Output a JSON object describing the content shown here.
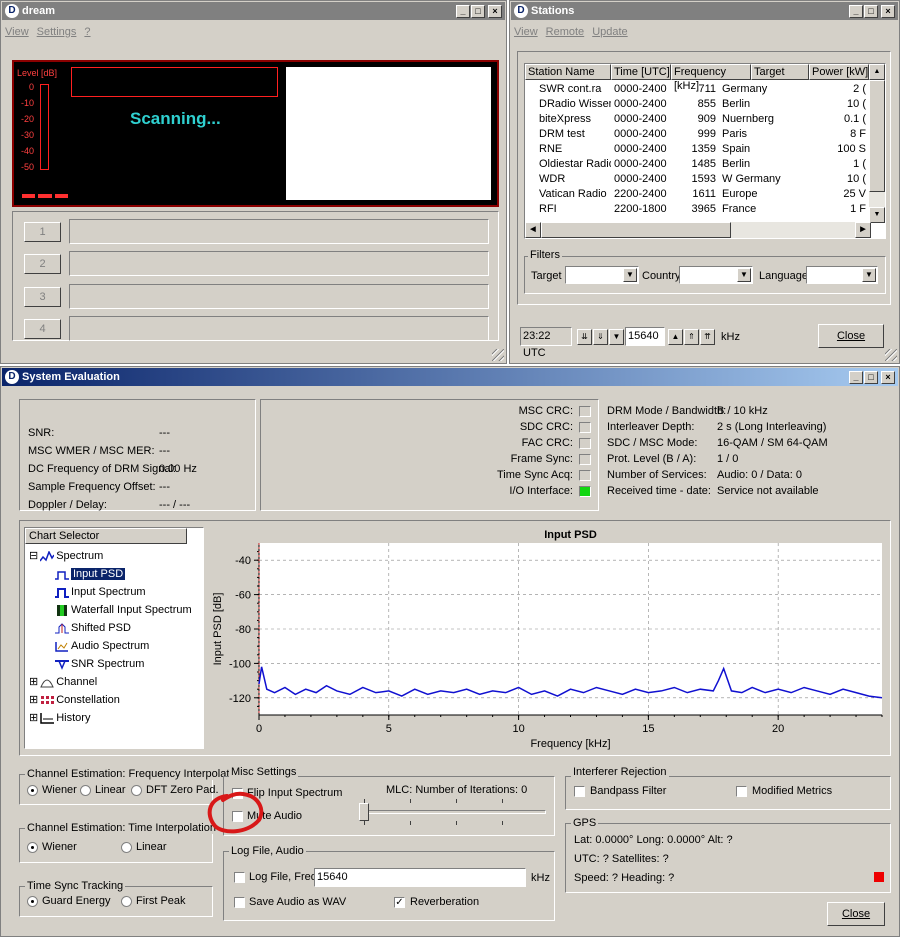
{
  "dream": {
    "title": "dream",
    "menu": [
      "View",
      "Settings",
      "?"
    ],
    "level_label": "Level [dB]",
    "level_ticks": [
      "0",
      "-10",
      "-20",
      "-30",
      "-40",
      "-50"
    ],
    "status": "Scanning...",
    "services": [
      "1",
      "2",
      "3",
      "4"
    ]
  },
  "stations": {
    "title": "Stations",
    "menu": [
      "View",
      "Remote",
      "Update"
    ],
    "columns": [
      "Station Name",
      "Time [UTC]",
      "Frequency [kHz]",
      "Target",
      "Power [kW]"
    ],
    "rows": [
      {
        "name": "SWR cont.ra",
        "time": "0000-2400",
        "freq": "711",
        "target": "Germany",
        "power": "2 (",
        "color": "#22c322"
      },
      {
        "name": "DRadio Wissen",
        "time": "0000-2400",
        "freq": "855",
        "target": "Berlin",
        "power": "10 (",
        "color": "#22c322"
      },
      {
        "name": "biteXpress",
        "time": "0000-2400",
        "freq": "909",
        "target": "Nuernberg",
        "power": "0.1 (",
        "color": "#22c322"
      },
      {
        "name": "DRM test",
        "time": "0000-2400",
        "freq": "999",
        "target": "Paris",
        "power": "8 F",
        "color": "#22c322"
      },
      {
        "name": "RNE",
        "time": "0000-2400",
        "freq": "1359",
        "target": "Spain",
        "power": "100 S",
        "color": "#22c322"
      },
      {
        "name": "Oldiestar Radio",
        "time": "0000-2400",
        "freq": "1485",
        "target": "Berlin",
        "power": "1 (",
        "color": "#22c322"
      },
      {
        "name": "WDR",
        "time": "0000-2400",
        "freq": "1593",
        "target": "W Germany",
        "power": "10 (",
        "color": "#22c322"
      },
      {
        "name": "Vatican Radio",
        "time": "2200-2400",
        "freq": "1611",
        "target": "Europe",
        "power": "25 V",
        "color": "#22c322"
      },
      {
        "name": "RFI",
        "time": "2200-1800",
        "freq": "3965",
        "target": "France",
        "power": "1 F",
        "color": "#22c322"
      }
    ],
    "filters_title": "Filters",
    "filter_target": "Target",
    "filter_country": "Country",
    "filter_language": "Language",
    "utc_time": "23:22 UTC",
    "frequency": "15640",
    "freq_unit": "kHz",
    "close": "Close"
  },
  "syseval": {
    "title": "System Evaluation",
    "metrics": [
      {
        "label": "SNR:",
        "value": "---"
      },
      {
        "label": "MSC WMER / MSC MER:",
        "value": "---"
      },
      {
        "label": "DC Frequency of DRM Signal:",
        "value": "0.00 Hz"
      },
      {
        "label": "Sample Frequency Offset:",
        "value": "---"
      },
      {
        "label": "Doppler / Delay:",
        "value": "--- / ---"
      }
    ],
    "crc": [
      {
        "label": "MSC CRC:",
        "state": "off"
      },
      {
        "label": "SDC CRC:",
        "state": "off"
      },
      {
        "label": "FAC CRC:",
        "state": "off"
      },
      {
        "label": "Frame Sync:",
        "state": "off"
      },
      {
        "label": "Time Sync Acq:",
        "state": "off"
      },
      {
        "label": "I/O Interface:",
        "state": "on"
      }
    ],
    "led_on": "#11d611",
    "led_off": "#d4d0c8",
    "mode_info": [
      {
        "label": "DRM Mode / Bandwidth:",
        "value": "B / 10 kHz"
      },
      {
        "label": "Interleaver Depth:",
        "value": "2 s (Long Interleaving)"
      },
      {
        "label": "SDC / MSC Mode:",
        "value": "16-QAM / SM 64-QAM"
      },
      {
        "label": "Prot. Level (B / A):",
        "value": "1 / 0"
      },
      {
        "label": "Number of Services:",
        "value": "Audio: 0 / Data: 0"
      },
      {
        "label": "Received time - date:",
        "value": "Service not available"
      }
    ],
    "chart_selector": {
      "header": "Chart Selector",
      "items": [
        {
          "label": "Spectrum",
          "icon": "spectrum-icon",
          "level": 0,
          "expander": "⊟"
        },
        {
          "label": "Input PSD",
          "icon": "psd-icon",
          "level": 1,
          "selected": true
        },
        {
          "label": "Input Spectrum",
          "icon": "input-spectrum-icon",
          "level": 1
        },
        {
          "label": "Waterfall Input Spectrum",
          "icon": "waterfall-icon",
          "level": 1
        },
        {
          "label": "Shifted PSD",
          "icon": "shifted-psd-icon",
          "level": 1
        },
        {
          "label": "Audio Spectrum",
          "icon": "audio-spectrum-icon",
          "level": 1
        },
        {
          "label": "SNR Spectrum",
          "icon": "snr-spectrum-icon",
          "level": 1
        },
        {
          "label": "Channel",
          "icon": "channel-icon",
          "level": 0,
          "expander": "⊞"
        },
        {
          "label": "Constellation",
          "icon": "constellation-icon",
          "level": 0,
          "expander": "⊞"
        },
        {
          "label": "History",
          "icon": "history-icon",
          "level": 0,
          "expander": "⊞"
        }
      ]
    },
    "freq_interp": {
      "title": "Channel Estimation: Frequency Interpolation",
      "options": [
        "Wiener",
        "Linear",
        "DFT Zero Pad."
      ],
      "selected": 0
    },
    "time_interp": {
      "title": "Channel Estimation: Time Interpolation",
      "options": [
        "Wiener",
        "Linear"
      ],
      "selected": 0
    },
    "time_sync": {
      "title": "Time Sync Tracking",
      "options": [
        "Guard Energy",
        "First Peak"
      ],
      "selected": 0
    },
    "misc": {
      "title": "Misc Settings",
      "flip": "Flip Input Spectrum",
      "mute": "Mute Audio",
      "mlc": "MLC: Number of Iterations: 0"
    },
    "logfile": {
      "title": "Log File, Audio",
      "log_label": "Log File, Freq:",
      "freq": "15640",
      "unit": "kHz",
      "save_wav": "Save Audio as WAV",
      "reverb": "Reverberation",
      "reverb_checked": true
    },
    "interferer": {
      "title": "Interferer Rejection",
      "bandpass": "Bandpass Filter",
      "modified": "Modified Metrics"
    },
    "gps": {
      "title": "GPS",
      "line1": "Lat: 0.0000°  Long: 0.0000°  Alt: ?",
      "line2": "UTC: ?  Satellites: ?",
      "line3": "Speed: ?  Heading: ?",
      "indicator": "#ee0000"
    },
    "close": "Close"
  },
  "annotation": {
    "color": "#d81818"
  },
  "chart_data": {
    "type": "line",
    "title": "Input PSD",
    "xlabel": "Frequency [kHz]",
    "ylabel": "Input PSD [dB]",
    "xlim": [
      0,
      24
    ],
    "ylim": [
      -130,
      -30
    ],
    "xticks": [
      0,
      5,
      10,
      15,
      20
    ],
    "yticks": [
      -40,
      -60,
      -80,
      -100,
      -120
    ],
    "grid": true,
    "series_color": "#1010d0",
    "series": [
      {
        "x": [
          0.0,
          0.1,
          0.3,
          0.6,
          1.0,
          1.4,
          1.8,
          2.2,
          2.6,
          3.0,
          3.5,
          4.0,
          4.5,
          5.0,
          5.5,
          6.0,
          6.5,
          7.0,
          7.5,
          8.0,
          8.5,
          9.0,
          9.5,
          10.0,
          10.5,
          11.0,
          11.5,
          12.0,
          12.5,
          13.0,
          13.5,
          14.0,
          14.5,
          15.0,
          15.5,
          16.0,
          16.5,
          17.0,
          17.5,
          17.7,
          17.9,
          18.2,
          18.6,
          19.0,
          19.5,
          20.0,
          20.5,
          21.0,
          21.5,
          22.0,
          22.5,
          23.0,
          23.5,
          24.0
        ],
        "y": [
          -112,
          -102,
          -115,
          -117,
          -114,
          -118,
          -115,
          -117,
          -113,
          -116,
          -118,
          -114,
          -117,
          -116,
          -119,
          -115,
          -118,
          -116,
          -117,
          -115,
          -118,
          -116,
          -117,
          -114,
          -118,
          -116,
          -119,
          -115,
          -117,
          -114,
          -116,
          -118,
          -115,
          -117,
          -116,
          -114,
          -117,
          -115,
          -116,
          -110,
          -103,
          -116,
          -117,
          -114,
          -117,
          -115,
          -117,
          -114,
          -116,
          -118,
          -115,
          -117,
          -119,
          -120
        ]
      }
    ]
  }
}
